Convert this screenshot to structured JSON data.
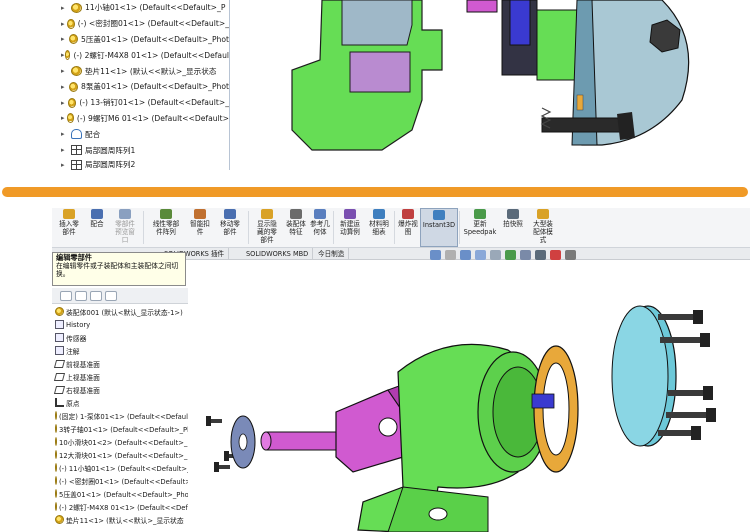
{
  "top_tree": [
    {
      "text": "11小轴01<1> (Default<<Default>_P",
      "icon": "gear-icon"
    },
    {
      "text": "(-) <密封圈01<1> (Default<<Default>_",
      "icon": "gear-icon"
    },
    {
      "text": "5压盖01<1> (Default<<Default>_Phot",
      "icon": "gear-icon"
    },
    {
      "text": "(-) 2螺钉-M4X8 01<1> (Default<<Defaul",
      "icon": "gear-icon"
    },
    {
      "text": "垫片11<1> (默认<<默认>_显示状态",
      "icon": "gear-icon"
    },
    {
      "text": "8泵盖01<1> (Default<<Default>_Phot",
      "icon": "gear-icon"
    },
    {
      "text": "(-) 13-销钉01<1> (Default<<Default>_",
      "icon": "gear-icon"
    },
    {
      "text": "(-) 9螺钉M6 01<1> (Default<<Default>",
      "icon": "gear-icon"
    },
    {
      "text": "配合",
      "icon": "mate-icon"
    },
    {
      "text": "局部圆周阵列1",
      "icon": "pattern-icon"
    },
    {
      "text": "局部圆周阵列2",
      "icon": "pattern-icon"
    }
  ],
  "ribbon": [
    {
      "label": "插入零\n部件",
      "color": "#d9a227"
    },
    {
      "label": "配合",
      "color": "#4a6fb0"
    },
    {
      "label": "零部件\n预览窗\n口",
      "color": "#8aa0c0",
      "dim": true
    },
    {
      "label": "线性零部\n件阵列",
      "color": "#5a8a3a"
    },
    {
      "label": "智能扣\n件",
      "color": "#c07030"
    },
    {
      "label": "移动零\n部件",
      "color": "#4a6fb0"
    },
    {
      "label": "显示隐\n藏的零\n部件",
      "color": "#d9a227"
    },
    {
      "label": "装配体\n特征",
      "color": "#6b6b6b"
    },
    {
      "label": "参考几\n何体",
      "color": "#5a7fbf"
    },
    {
      "label": "新建运\n动算例",
      "color": "#7a4fb0"
    },
    {
      "label": "材料明\n细表",
      "color": "#3f7fbf"
    },
    {
      "label": "爆炸视\n图",
      "color": "#c04040"
    },
    {
      "label": "Instant3D",
      "color": "#3f7fbf",
      "active": true
    },
    {
      "label": "更新\nSpeedpak",
      "color": "#4a9a4a"
    },
    {
      "label": "拍快照",
      "color": "#5a6a7a"
    },
    {
      "label": "大型装\n配体模\n式",
      "color": "#d9a227"
    }
  ],
  "tabs": [
    "SOLIDWORKS 插件",
    "SOLIDWORKS MBD",
    "今日制造"
  ],
  "tooltip": {
    "title": "编辑零部件",
    "body": "在编辑零件或子装配体和主装配体之间切换。"
  },
  "feature_tree": {
    "root": "装配体001 (默认<默认_显示状态-1>)",
    "items": [
      {
        "text": "History",
        "icon": "history-icon"
      },
      {
        "text": "传感器",
        "icon": "sensor-icon"
      },
      {
        "text": "注解",
        "icon": "annotation-icon"
      },
      {
        "text": "前视基准面",
        "icon": "plane-icon"
      },
      {
        "text": "上视基准面",
        "icon": "plane-icon"
      },
      {
        "text": "右视基准面",
        "icon": "plane-icon"
      },
      {
        "text": "原点",
        "icon": "origin-icon"
      },
      {
        "text": "(固定) 1-泵体01<1> (Default<<Default",
        "icon": "gear-icon"
      },
      {
        "text": "3转子轴01<1> (Default<<Default>_Ph",
        "icon": "gear-icon"
      },
      {
        "text": "10小滑块01<2> (Default<<Default>_P",
        "icon": "gear-icon"
      },
      {
        "text": "12大滑块01<1> (Default<<Default>_P",
        "icon": "gear-icon"
      },
      {
        "text": "(-) 11小轴01<1> (Default<<Default>_F",
        "icon": "gear-icon"
      },
      {
        "text": "(-) <密封圈01<1> (Default<<Default>_",
        "icon": "gear-icon"
      },
      {
        "text": "5压盖01<1> (Default<<Default>_Phot",
        "icon": "gear-icon"
      },
      {
        "text": "(-) 2螺钉-M4X8 01<1> (Default<<Defa",
        "icon": "gear-icon"
      },
      {
        "text": "垫片11<1> (默认<<默认>_显示状态",
        "icon": "gear-icon"
      }
    ]
  },
  "colors": {
    "accent_divider": "#f09a27",
    "housing_green": "#66dd55",
    "rotor_magenta": "#d05ad0",
    "gasket_orange": "#e8a83a",
    "cover_cyan": "#6cc8d8",
    "disk_blue": "#7a8ab8"
  }
}
